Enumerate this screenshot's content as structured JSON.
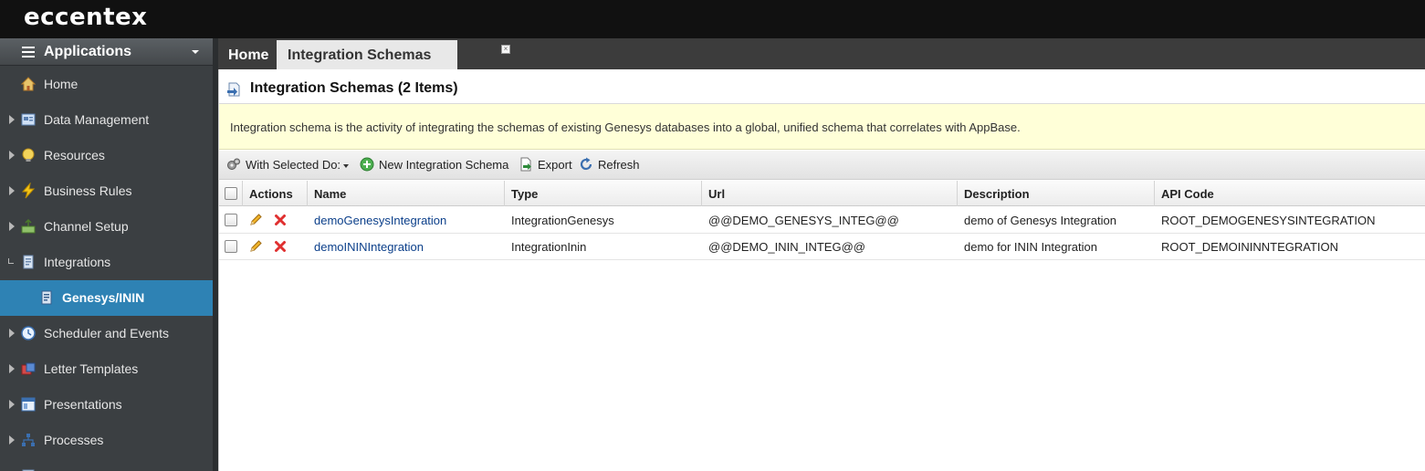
{
  "app": {
    "logo": "eccentex"
  },
  "sidebar": {
    "header": {
      "title": "Applications"
    },
    "items": [
      {
        "label": "Home",
        "icon": "home-icon",
        "arrow": "none",
        "active": false
      },
      {
        "label": "Data Management",
        "icon": "data-management-icon",
        "arrow": "collapsed",
        "active": false
      },
      {
        "label": "Resources",
        "icon": "resources-icon",
        "arrow": "collapsed",
        "active": false
      },
      {
        "label": "Business Rules",
        "icon": "lightning-icon",
        "arrow": "collapsed",
        "active": false
      },
      {
        "label": "Channel Setup",
        "icon": "channel-icon",
        "arrow": "collapsed",
        "active": false
      },
      {
        "label": "Integrations",
        "icon": "integrations-icon",
        "arrow": "expanded",
        "active": false
      },
      {
        "label": "Genesys/ININ",
        "icon": "document-icon",
        "arrow": "none",
        "active": true
      },
      {
        "label": "Scheduler and Events",
        "icon": "clock-icon",
        "arrow": "collapsed",
        "active": false
      },
      {
        "label": "Letter Templates",
        "icon": "letter-icon",
        "arrow": "collapsed",
        "active": false
      },
      {
        "label": "Presentations",
        "icon": "presentation-icon",
        "arrow": "collapsed",
        "active": false
      },
      {
        "label": "Processes",
        "icon": "processes-icon",
        "arrow": "collapsed",
        "active": false
      }
    ]
  },
  "tabs": [
    {
      "label": "Home",
      "active": false
    },
    {
      "label": "Integration Schemas",
      "active": true,
      "close": "×"
    }
  ],
  "page": {
    "title": "Integration Schemas (2 Items)",
    "info": "Integration schema is the activity of integrating the schemas of existing Genesys databases into a global, unified schema that correlates with AppBase."
  },
  "toolbar": {
    "with_selected": "With Selected Do:",
    "new_schema": "New Integration Schema",
    "export": "Export",
    "refresh": "Refresh"
  },
  "table": {
    "columns": [
      "Actions",
      "Name",
      "Type",
      "Url",
      "Description",
      "API Code"
    ],
    "rows": [
      {
        "name": "demoGenesysIntegration",
        "type": "IntegrationGenesys",
        "url": "@@DEMO_GENESYS_INTEG@@",
        "description": "demo of Genesys Integration",
        "api_code": "ROOT_DEMOGENESYSINTEGRATION"
      },
      {
        "name": "demoININIntegration",
        "type": "IntegrationInin",
        "url": "@@DEMO_ININ_INTEG@@",
        "description": "demo for ININ Integration",
        "api_code": "ROOT_DEMOININNTEGRATION"
      }
    ]
  },
  "colors": {
    "topbar": "#111111",
    "sidebar": "#3b3f42",
    "active_nav": "#2e82b4",
    "info_bg": "#ffffd8",
    "link": "#0b3f8a",
    "delete": "#e03030"
  }
}
